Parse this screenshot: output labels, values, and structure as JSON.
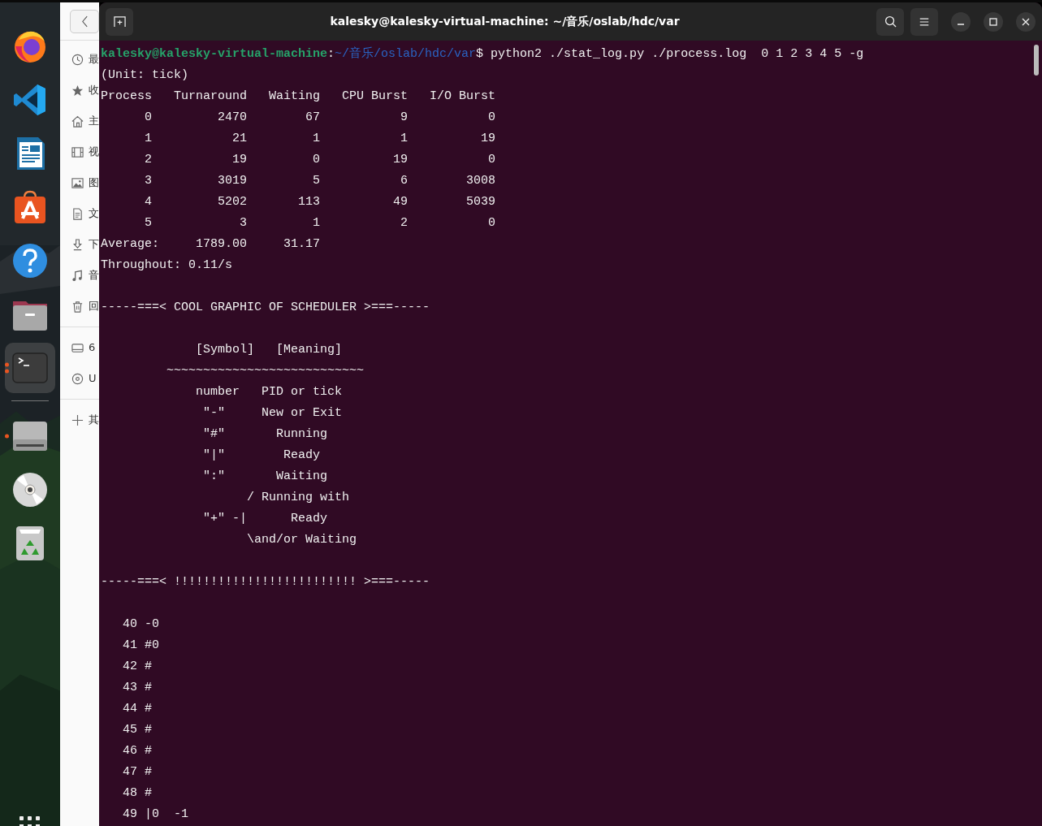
{
  "dock": {
    "items": [
      {
        "kind": "firefox",
        "running": false,
        "selected": false
      },
      {
        "kind": "vscode",
        "running": false,
        "selected": false
      },
      {
        "kind": "writer",
        "running": false,
        "selected": false
      },
      {
        "kind": "appstore",
        "running": false,
        "selected": false
      },
      {
        "kind": "help",
        "running": false,
        "selected": false
      },
      {
        "kind": "files",
        "running": false,
        "selected": false
      },
      {
        "kind": "terminal",
        "running": true,
        "selected": true
      },
      {
        "kind": "separator"
      },
      {
        "kind": "drive",
        "running": true,
        "selected": false
      },
      {
        "kind": "disc",
        "running": false,
        "selected": false
      },
      {
        "kind": "trash",
        "running": false,
        "selected": false
      }
    ]
  },
  "files_sidebar": {
    "sections": [
      {
        "items": [
          {
            "kind": "recent",
            "label": "最"
          },
          {
            "kind": "starred",
            "label": "收"
          },
          {
            "kind": "home",
            "label": "主"
          },
          {
            "kind": "videos",
            "label": "视"
          },
          {
            "kind": "pictures",
            "label": "图"
          },
          {
            "kind": "documents",
            "label": "文"
          },
          {
            "kind": "downloads",
            "label": "下"
          },
          {
            "kind": "music",
            "label": "音"
          },
          {
            "kind": "trash",
            "label": "回"
          }
        ]
      },
      {
        "items": [
          {
            "kind": "disk",
            "label": "6"
          },
          {
            "kind": "disc",
            "label": "U"
          }
        ]
      },
      {
        "items": [
          {
            "kind": "other",
            "label": "其"
          }
        ]
      }
    ]
  },
  "terminal": {
    "title": "kalesky@kalesky-virtual-machine: ~/音乐/oslab/hdc/var",
    "prompt": {
      "user_host": "kalesky@kalesky-virtual-machine",
      "separator": ":",
      "path": "~/音乐/oslab/hdc/var",
      "command": "$ python2 ./stat_log.py ./process.log  0 1 2 3 4 5 -g"
    },
    "blocks": [
      {
        "kind": "stats",
        "unit": "(Unit: tick)",
        "columns": [
          "Process",
          "Turnaround",
          "Waiting",
          "CPU Burst",
          "I/O Burst"
        ],
        "rows": [
          [
            "0",
            "2470",
            "67",
            "9",
            "0"
          ],
          [
            "1",
            "21",
            "1",
            "1",
            "19"
          ],
          [
            "2",
            "19",
            "0",
            "19",
            "0"
          ],
          [
            "3",
            "3019",
            "5",
            "6",
            "3008"
          ],
          [
            "4",
            "5202",
            "113",
            "49",
            "5039"
          ],
          [
            "5",
            "3",
            "1",
            "2",
            "0"
          ]
        ],
        "average": [
          "Average:",
          "1789.00",
          "31.17"
        ],
        "throughput": "Throughout: 0.11/s"
      },
      {
        "kind": "banner",
        "lines": [
          "-----===< COOL GRAPHIC OF SCHEDULER >===-----"
        ]
      },
      {
        "kind": "legend",
        "lines": [
          "             [Symbol]   [Meaning]",
          "         ~~~~~~~~~~~~~~~~~~~~~~~~~~~",
          "             number   PID or tick",
          "              \"-\"     New or Exit",
          "              \"#\"       Running",
          "              \"|\"        Ready",
          "              \":\"       Waiting",
          "                    / Running with",
          "              \"+\" -|      Ready",
          "                    \\and/or Waiting"
        ]
      },
      {
        "kind": "banner",
        "lines": [
          "-----===< !!!!!!!!!!!!!!!!!!!!!!!!! >===-----"
        ]
      },
      {
        "kind": "timeline",
        "lines": [
          "   40 -0",
          "   41 #0",
          "   42 #",
          "   43 #",
          "   44 #",
          "   45 #",
          "   46 #",
          "   47 #",
          "   48 #",
          "   49 |0  -1"
        ]
      }
    ]
  }
}
